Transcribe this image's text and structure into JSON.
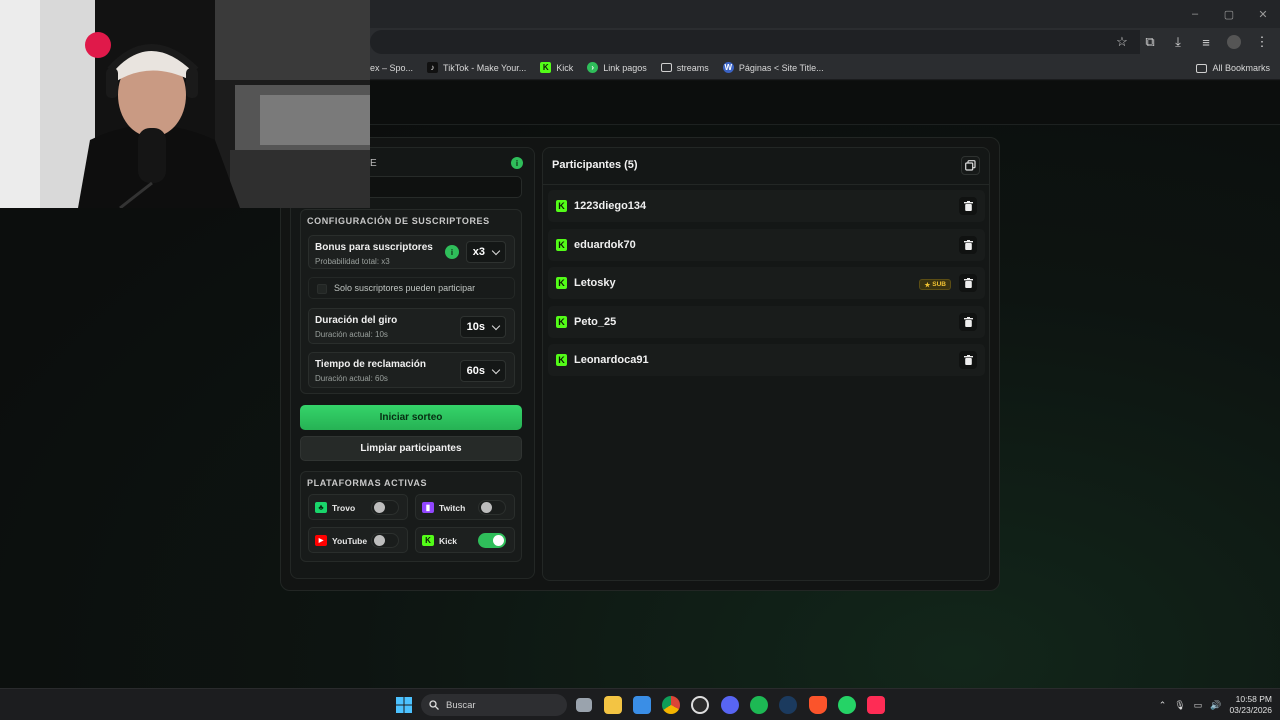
{
  "browser": {
    "window_controls": [
      "–",
      "▢",
      "✕"
    ],
    "bookmarks": [
      {
        "label": "ex – Spo...",
        "icon": "spotify-icon",
        "color": "#1db954"
      },
      {
        "label": "TikTok - Make Your...",
        "icon": "tiktok-icon",
        "color": "#111111"
      },
      {
        "label": "Kick",
        "icon": "kick-icon",
        "color": "#53fc18"
      },
      {
        "label": "Link pagos",
        "icon": "payment-icon",
        "color": "#2fbe5a"
      },
      {
        "label": "streams",
        "icon": "folder-icon",
        "color": "#cfcfcf"
      },
      {
        "label": "Páginas < Site Title...",
        "icon": "wordpress-icon",
        "color": "#3b63c4"
      }
    ],
    "all_bookmarks": "All Bookmarks"
  },
  "left_panel": {
    "partial_title": "E",
    "subscribers_section": {
      "title": "CONFIGURACIÓN DE SUSCRIPTORES",
      "bonus": {
        "title": "Bonus para suscriptores",
        "subtitle": "Probabilidad total: x3",
        "value": "x3"
      },
      "only_subs_label": "Solo suscriptores pueden participar",
      "spin_duration": {
        "title": "Duración del giro",
        "subtitle": "Duración actual: 10s",
        "value": "10s"
      },
      "claim_time": {
        "title": "Tiempo de reclamación",
        "subtitle": "Duración actual: 60s",
        "value": "60s"
      }
    },
    "start_button": "Iniciar sorteo",
    "clear_button": "Limpiar participantes",
    "platforms_section": {
      "title": "PLATAFORMAS ACTIVAS",
      "platforms": [
        {
          "name": "Trovo",
          "enabled": false,
          "color": "#19d66b"
        },
        {
          "name": "Twitch",
          "enabled": false,
          "color": "#9146ff"
        },
        {
          "name": "YouTube",
          "enabled": false,
          "color": "#ff0000"
        },
        {
          "name": "Kick",
          "enabled": true,
          "color": "#53fc18"
        }
      ]
    }
  },
  "participants": {
    "title": "Participantes (5)",
    "items": [
      {
        "name": "1223diego134",
        "platform": "Kick",
        "sub": false
      },
      {
        "name": "eduardok70",
        "platform": "Kick",
        "sub": false
      },
      {
        "name": "Letosky",
        "platform": "Kick",
        "sub": true,
        "badge": "SUB"
      },
      {
        "name": "Peto_25",
        "platform": "Kick",
        "sub": false
      },
      {
        "name": "Leonardoca91",
        "platform": "Kick",
        "sub": false
      }
    ]
  },
  "taskbar": {
    "search_placeholder": "Buscar",
    "time": "10:58 PM",
    "date": "03/23/2026"
  }
}
